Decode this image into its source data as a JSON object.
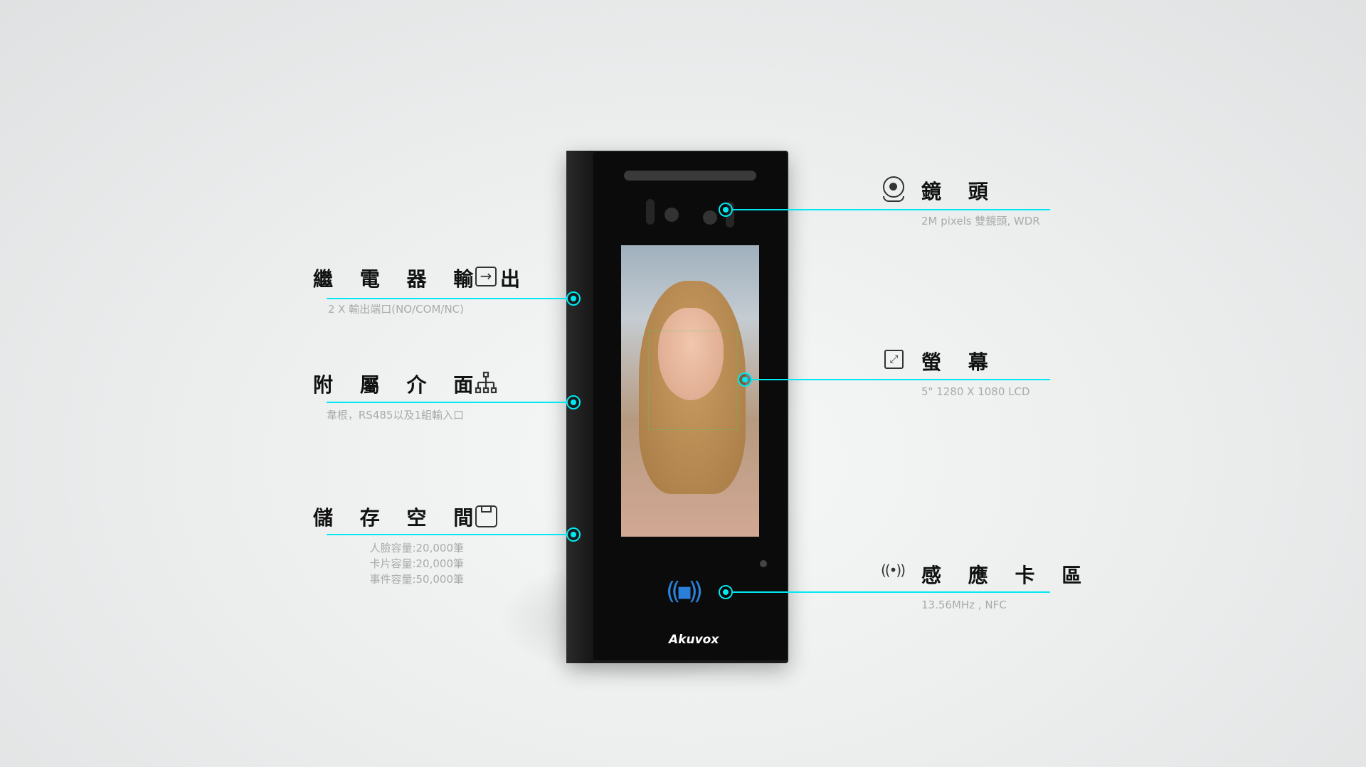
{
  "device": {
    "brand": "Akuvox"
  },
  "accent_color": "#00e9f2",
  "features": {
    "relay": {
      "title": "繼 電 器 輸 出",
      "desc": "2 X 輸出端口(NO/COM/NC)",
      "icon": "exit-icon"
    },
    "interface": {
      "title": "附 屬 介 面",
      "desc": "韋根，RS485以及1組輸入口",
      "icon": "network-tree-icon"
    },
    "storage": {
      "title": "儲 存 空 間",
      "desc": [
        "人臉容量:20,000筆",
        "卡片容量:20,000筆",
        "事件容量:50,000筆"
      ],
      "icon": "storage-icon"
    },
    "camera": {
      "title": "鏡 頭",
      "desc": "2M pixels 雙鏡頭, WDR",
      "icon": "webcam-icon"
    },
    "screen": {
      "title": "螢 幕",
      "desc": "5\" 1280 X 1080 LCD",
      "icon": "expand-icon"
    },
    "nfc": {
      "title": "感 應 卡 區",
      "desc": "13.56MHz , NFC",
      "icon": "wireless-signal-icon"
    }
  }
}
